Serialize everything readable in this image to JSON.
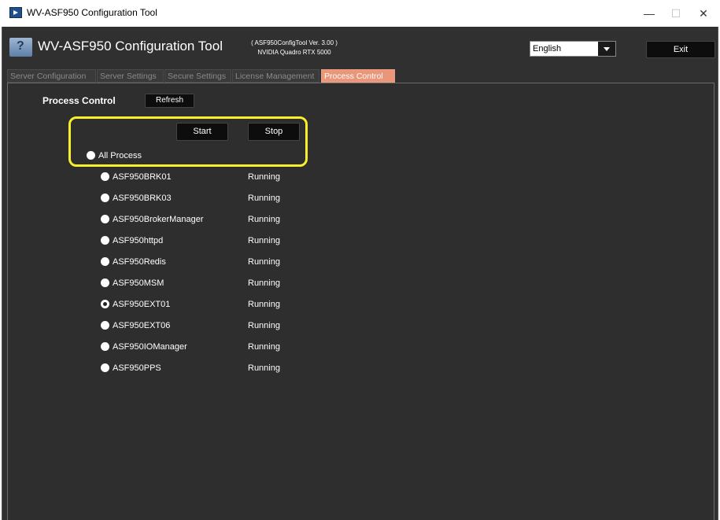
{
  "window": {
    "title": "WV-ASF950 Configuration Tool",
    "minimize": "—",
    "maximize": "☐",
    "close": "✕"
  },
  "header": {
    "app_title": "WV-ASF950 Configuration Tool",
    "version": "( ASF950ConfigTool Ver. 3.00 )",
    "gpu": "NVIDIA Quadro RTX 5000",
    "language": "English",
    "exit_label": "Exit",
    "logo_text": "?"
  },
  "tabs": [
    {
      "label": "Server Configuration",
      "active": false
    },
    {
      "label": "Server Settings",
      "active": false
    },
    {
      "label": "Secure Settings",
      "active": false
    },
    {
      "label": "License Management",
      "active": false
    },
    {
      "label": "Process Control",
      "active": true
    }
  ],
  "process_control": {
    "title": "Process Control",
    "refresh_label": "Refresh",
    "start_label": "Start",
    "stop_label": "Stop",
    "all_process_label": "All Process",
    "processes": [
      {
        "name": "ASF950BRK01",
        "status": "Running",
        "selected": false
      },
      {
        "name": "ASF950BRK03",
        "status": "Running",
        "selected": false
      },
      {
        "name": "ASF950BrokerManager",
        "status": "Running",
        "selected": false
      },
      {
        "name": "ASF950httpd",
        "status": "Running",
        "selected": false
      },
      {
        "name": "ASF950Redis",
        "status": "Running",
        "selected": false
      },
      {
        "name": "ASF950MSM",
        "status": "Running",
        "selected": false
      },
      {
        "name": "ASF950EXT01",
        "status": "Running",
        "selected": true
      },
      {
        "name": "ASF950EXT06",
        "status": "Running",
        "selected": false
      },
      {
        "name": "ASF950IOManager",
        "status": "Running",
        "selected": false
      },
      {
        "name": "ASF950PPS",
        "status": "Running",
        "selected": false
      }
    ]
  },
  "colors": {
    "highlight": "#f7ee2c",
    "active_tab": "#e9967a",
    "background": "#2e2e2e"
  }
}
